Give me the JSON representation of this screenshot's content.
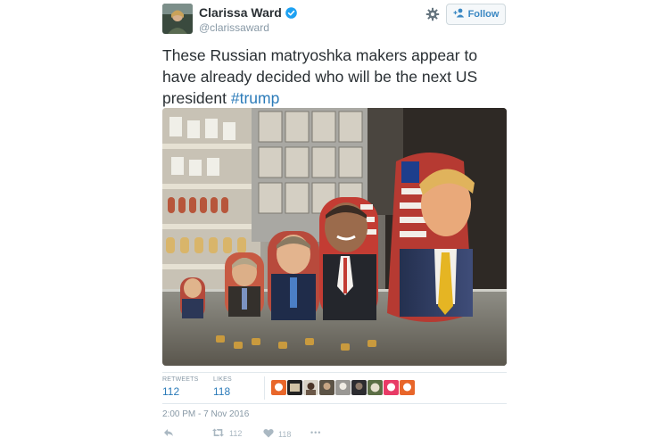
{
  "user": {
    "name": "Clarissa Ward",
    "handle": "@clarissaward"
  },
  "follow_button": {
    "label": "Follow"
  },
  "tweet": {
    "text": "These Russian matryoshka makers appear to have already decided who will be the next US president ",
    "hashtag": "#trump"
  },
  "stats": {
    "retweets_label": "RETWEETS",
    "retweets_count": "112",
    "likes_label": "LIKES",
    "likes_count": "118"
  },
  "timestamp": "2:00 PM - 7 Nov 2016",
  "actions": {
    "retweet_count": "112",
    "like_count": "118",
    "more_label": "•••"
  },
  "icons": [
    "verified-badge-icon",
    "gear-icon",
    "follow-person-icon",
    "reply-icon",
    "retweet-icon",
    "heart-icon",
    "more-icon"
  ],
  "colors": {
    "link": "#2b7bb9",
    "muted": "#8899a6",
    "verified": "#1da1f2",
    "text": "#292f33"
  }
}
